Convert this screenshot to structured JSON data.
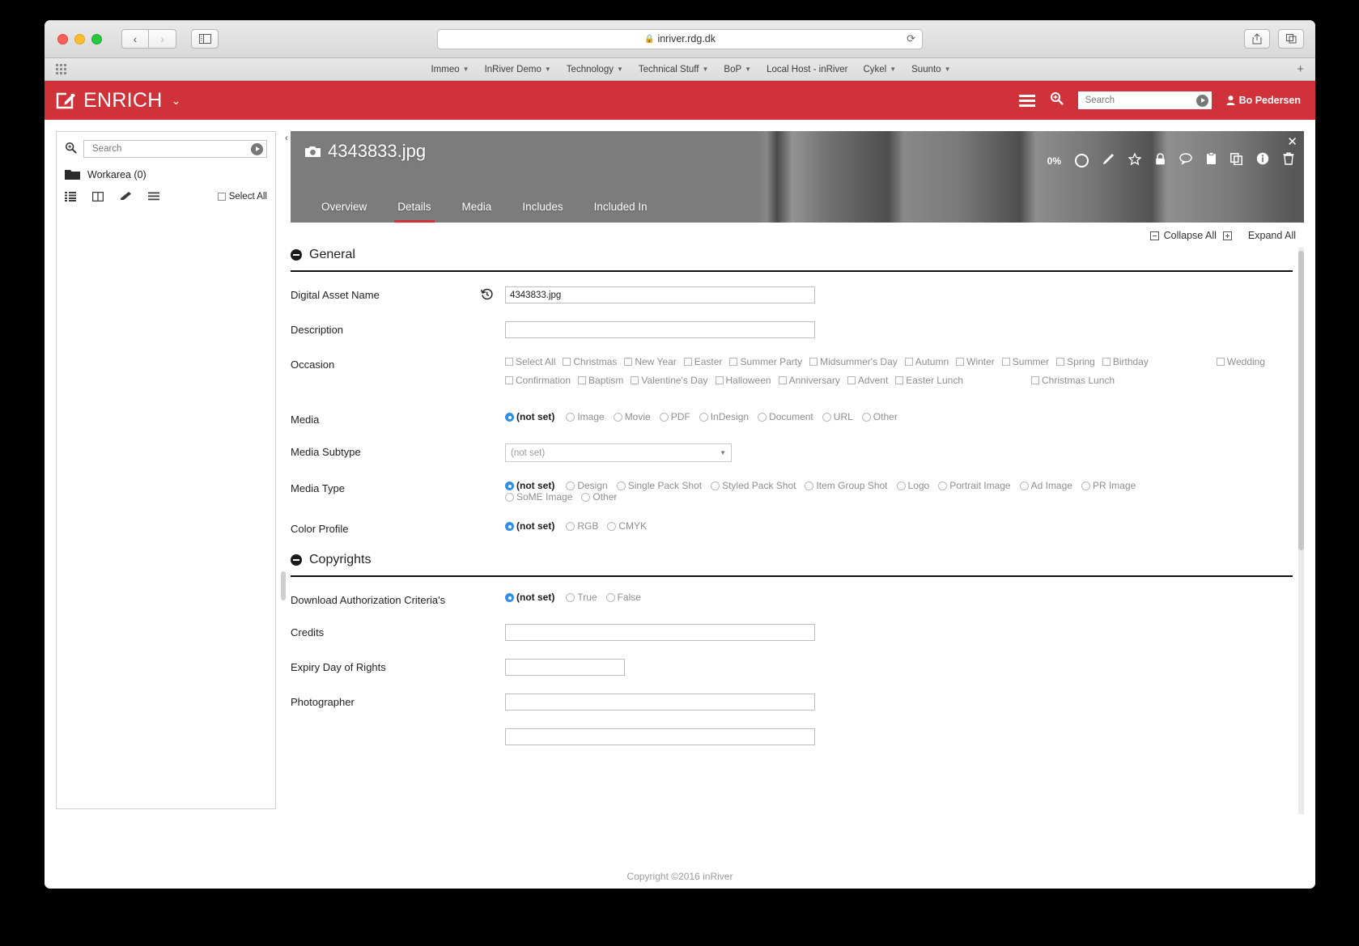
{
  "browser": {
    "url": "inriver.rdg.dk",
    "lock_icon": "lock-icon",
    "reload_icon": "reload-icon",
    "back_icon": "chevron-left-icon",
    "forward_icon": "chevron-right-icon",
    "sidebar_icon": "sidebar-toggle-icon",
    "share_icon": "share-icon",
    "tabs_icon": "new-tab-icon",
    "plus_label": "+",
    "apps_icon": "apps-grid-icon",
    "bookmarks": [
      {
        "label": "Immeo",
        "has_caret": true
      },
      {
        "label": "InRiver Demo",
        "has_caret": true
      },
      {
        "label": "Technology",
        "has_caret": true
      },
      {
        "label": "Technical Stuff",
        "has_caret": true
      },
      {
        "label": "BoP",
        "has_caret": true
      },
      {
        "label": "Local Host - inRiver",
        "has_caret": false
      },
      {
        "label": "Cykel",
        "has_caret": true
      },
      {
        "label": "Suunto",
        "has_caret": true
      }
    ]
  },
  "appbar": {
    "brand": "ENRICH",
    "brand_icon": "edit-pencil-icon",
    "brand_caret": "chevron-down-icon",
    "menu_icon": "hamburger-menu-icon",
    "search_icon": "magnifier-plus-icon",
    "search_placeholder": "Search",
    "search_value": "",
    "search_go_icon": "play-circle-icon",
    "user_icon": "user-icon",
    "user_name": "Bo Pedersen",
    "accent_color": "#cf3339"
  },
  "leftpanel": {
    "search_icon": "magnifier-plus-icon",
    "search_placeholder": "Search",
    "search_value": "",
    "search_go_icon": "play-circle-icon",
    "workarea_icon": "folder-icon",
    "workarea_label": "Workarea (0)",
    "toolbar_icons": [
      "list-view-icon",
      "columns-view-icon",
      "eraser-icon",
      "menu-lines-icon"
    ],
    "select_all_label": "Select All",
    "collapse_icon": "chevron-left-icon"
  },
  "hero": {
    "camera_icon": "camera-icon",
    "title": "4343833.jpg",
    "completeness": "0%",
    "close_icon": "close-icon",
    "icons": [
      "completeness-ring-icon",
      "pencil-icon",
      "star-icon",
      "lock-icon",
      "comment-icon",
      "clipboard-icon",
      "copy-icon",
      "info-icon",
      "trash-icon"
    ],
    "tabs": [
      {
        "label": "Overview",
        "active": false
      },
      {
        "label": "Details",
        "active": true
      },
      {
        "label": "Media",
        "active": false
      },
      {
        "label": "Includes",
        "active": false
      },
      {
        "label": "Included In",
        "active": false
      }
    ]
  },
  "expandbar": {
    "collapse_all": "Collapse All",
    "expand_all": "Expand All",
    "collapse_icon": "minus-box-icon",
    "expand_icon": "plus-box-icon"
  },
  "sections": {
    "general": {
      "title": "General",
      "toggle_icon": "minus-circle-icon",
      "digital_asset_name": {
        "label": "Digital Asset Name",
        "history_icon": "history-revert-icon",
        "value": "4343833.jpg",
        "placeholder": ""
      },
      "description": {
        "label": "Description",
        "value": "",
        "placeholder": ""
      },
      "occasion": {
        "label": "Occasion",
        "select_all": "Select All",
        "options": [
          "Christmas",
          "New Year",
          "Easter",
          "Summer Party",
          "Midsummer's Day",
          "Autumn",
          "Winter",
          "Summer",
          "Spring",
          "Birthday",
          "Wedding",
          "Confirmation",
          "Baptism",
          "Valentine's Day",
          "Halloween",
          "Anniversary",
          "Advent",
          "Easter Lunch",
          "Christmas Lunch"
        ]
      },
      "media": {
        "label": "Media",
        "options": [
          "(not set)",
          "Image",
          "Movie",
          "PDF",
          "InDesign",
          "Document",
          "URL",
          "Other"
        ],
        "selected": "(not set)"
      },
      "media_subtype": {
        "label": "Media Subtype",
        "value": "(not set)",
        "caret_icon": "chevron-down-icon"
      },
      "media_type": {
        "label": "Media Type",
        "options": [
          "(not set)",
          "Design",
          "Single Pack Shot",
          "Styled Pack Shot",
          "Item Group Shot",
          "Logo",
          "Portrait Image",
          "Ad Image",
          "PR Image",
          "SoME Image",
          "Other"
        ],
        "selected": "(not set)"
      },
      "color_profile": {
        "label": "Color Profile",
        "options": [
          "(not set)",
          "RGB",
          "CMYK"
        ],
        "selected": "(not set)"
      }
    },
    "copyrights": {
      "title": "Copyrights",
      "toggle_icon": "minus-circle-icon",
      "download_auth": {
        "label": "Download Authorization Criteria's",
        "options": [
          "(not set)",
          "True",
          "False"
        ],
        "selected": "(not set)"
      },
      "credits": {
        "label": "Credits",
        "value": ""
      },
      "expiry": {
        "label": "Expiry Day of Rights",
        "value": ""
      },
      "photographer": {
        "label": "Photographer",
        "value": ""
      }
    }
  },
  "footer": {
    "text": "Copyright ©2016 inRiver"
  }
}
